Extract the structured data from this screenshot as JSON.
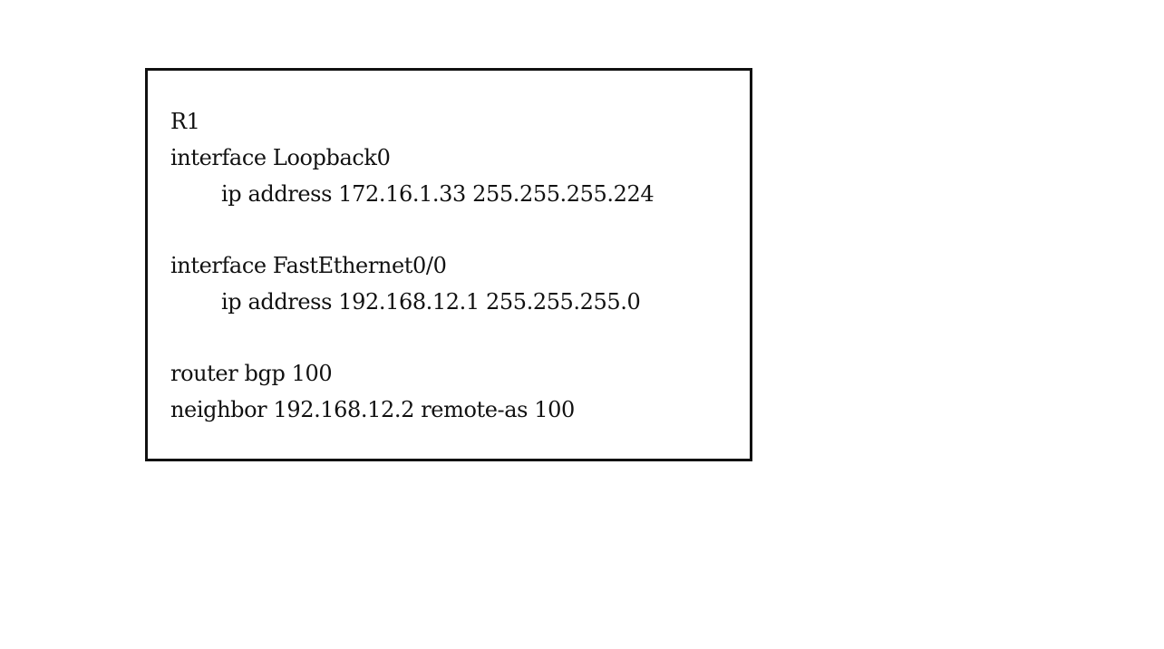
{
  "config": {
    "hostname": "R1",
    "interfaces": [
      {
        "command": "interface Loopback0",
        "ip_line": "ip address 172.16.1.33 255.255.255.224"
      },
      {
        "command": "interface FastEthernet0/0",
        "ip_line": "ip address 192.168.12.1 255.255.255.0"
      }
    ],
    "bgp": {
      "command": "router bgp 100",
      "neighbor_line": "neighbor 192.168.12.2 remote-as 100"
    }
  },
  "colors": {
    "text": "#111111",
    "border": "#111111",
    "background": "#ffffff"
  }
}
